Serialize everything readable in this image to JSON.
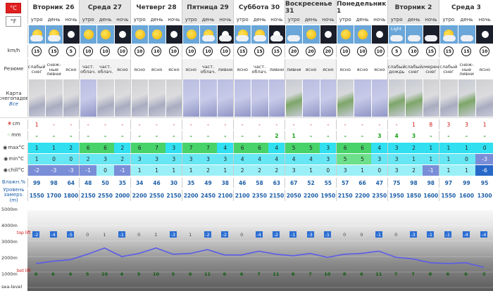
{
  "units": {
    "celsius": "°C",
    "fahrenheit": "°F"
  },
  "days": [
    {
      "label": "Вторник 26",
      "periods": [
        "утро",
        "день",
        "ночь"
      ]
    },
    {
      "label": "Среда 27",
      "periods": [
        "утро",
        "день",
        "ночь"
      ]
    },
    {
      "label": "Четверг 28",
      "periods": [
        "утро",
        "день",
        "ночь"
      ]
    },
    {
      "label": "Пятница 29",
      "periods": [
        "утро",
        "день",
        "ночь"
      ]
    },
    {
      "label": "Суббота 30",
      "periods": [
        "утро",
        "день",
        "ночь"
      ]
    },
    {
      "label": "Воскресенье 31",
      "periods": [
        "утро",
        "день",
        "ночь"
      ]
    },
    {
      "label": "Понедельник 1",
      "periods": [
        "утро",
        "день",
        "ночь"
      ]
    },
    {
      "label": "Вторник 2",
      "periods": [
        "утро",
        "день",
        "ночь"
      ]
    },
    {
      "label": "Среда 3",
      "periods": [
        "утро",
        "день",
        "ночь"
      ]
    }
  ],
  "row_labels": {
    "wind": "km/h",
    "summary": "Резюме",
    "snowmap": "Карта снегопадов",
    "snowmap_link": "Все",
    "snow": "cm",
    "rain": "mm",
    "max": "max°C",
    "min": "min°C",
    "chill": "chill°C",
    "humidity": "Влажн.%",
    "freezing": "Уровень замерз. (m)"
  },
  "light_label": "Light",
  "wind": [
    15,
    15,
    5,
    10,
    10,
    10,
    10,
    10,
    10,
    10,
    10,
    10,
    15,
    15,
    15,
    20,
    20,
    20,
    10,
    10,
    10,
    5,
    10,
    15,
    15,
    15,
    10
  ],
  "summary": [
    "слабый снег",
    "снеж-ные ливни",
    "ясно",
    "част. облач.",
    "част. облач.",
    "ясно",
    "ясно",
    "ясно",
    "ясно",
    "ясно",
    "част. облач.",
    "ливни",
    "ясно",
    "част. облач.",
    "ливни",
    "ливни",
    "ясно",
    "ясно",
    "ясно",
    "ясно",
    "ясно",
    "слабый дождь",
    "слабый снег",
    "умерен. снег",
    "слабый снег",
    "снеж-ные ливни",
    "ясно"
  ],
  "snow": [
    "1",
    "-",
    "-",
    "-",
    "-",
    "-",
    "-",
    "-",
    "-",
    "-",
    "-",
    "-",
    "-",
    "-",
    "-",
    "-",
    "-",
    "-",
    "-",
    "-",
    "-",
    "-",
    "1",
    "8",
    "3",
    "3",
    "1"
  ],
  "rain": [
    "-",
    "-",
    "-",
    "-",
    "-",
    "-",
    "-",
    "-",
    "-",
    "-",
    "-",
    "-",
    "-",
    "-",
    "2",
    "1",
    "-",
    "-",
    "-",
    "-",
    "3",
    "4",
    "3",
    "-",
    "-",
    "-",
    "-"
  ],
  "max": [
    "1",
    "1",
    "2",
    "6",
    "6",
    "2",
    "6",
    "7",
    "3",
    "7",
    "7",
    "4",
    "6",
    "6",
    "4",
    "5",
    "5",
    "3",
    "6",
    "6",
    "4",
    "3",
    "2",
    "1",
    "1",
    "1",
    "0"
  ],
  "min": [
    "1",
    "0",
    "0",
    "2",
    "3",
    "2",
    "3",
    "3",
    "3",
    "3",
    "3",
    "3",
    "4",
    "4",
    "4",
    "4",
    "4",
    "3",
    "5",
    "5",
    "3",
    "3",
    "1",
    "1",
    "1",
    "0",
    "-3"
  ],
  "chill": [
    "-2",
    "-3",
    "-3",
    "-1",
    "0",
    "-1",
    "1",
    "1",
    "1",
    "1",
    "2",
    "1",
    "2",
    "2",
    "2",
    "3",
    "1",
    "0",
    "3",
    "1",
    "0",
    "3",
    "2",
    "-1",
    "1",
    "1",
    "-6"
  ],
  "humidity": [
    "99",
    "98",
    "64",
    "48",
    "50",
    "35",
    "34",
    "46",
    "30",
    "35",
    "49",
    "38",
    "46",
    "58",
    "63",
    "67",
    "52",
    "55",
    "57",
    "66",
    "47",
    "75",
    "98",
    "98",
    "97",
    "99",
    "95"
  ],
  "freezing": [
    "1550",
    "1700",
    "1800",
    "2150",
    "2550",
    "2000",
    "2200",
    "2550",
    "2150",
    "2200",
    "2450",
    "2100",
    "2100",
    "2350",
    "2150",
    "2050",
    "2200",
    "1950",
    "2150",
    "2200",
    "2350",
    "1950",
    "1850",
    "1600",
    "1550",
    "1600",
    "1300"
  ],
  "profile": {
    "altitudes": [
      "5000m",
      "4000m",
      "3000m",
      "2000m",
      "1000m",
      "sea-level"
    ],
    "top_lift": "top lift",
    "bot_lift": "bot lift",
    "top_temps": [
      "-2",
      "-4",
      "-5",
      "0",
      "1",
      "-1",
      "0",
      "1",
      "-3",
      "1",
      "-2",
      "-2",
      "0",
      "-4",
      "-2",
      "-1",
      "-3",
      "-1",
      "0",
      "0",
      "-1",
      "0",
      "-3",
      "-1",
      "-1",
      "-4",
      "-4"
    ],
    "bot_temps": [
      "6",
      "6",
      "4",
      "5",
      "10",
      "4",
      "5",
      "10",
      "5",
      "6",
      "11",
      "6",
      "6",
      "7",
      "11",
      "8",
      "7",
      "10",
      "8",
      "6",
      "11",
      "7",
      "7",
      "8",
      "6",
      "6",
      "3"
    ]
  }
}
